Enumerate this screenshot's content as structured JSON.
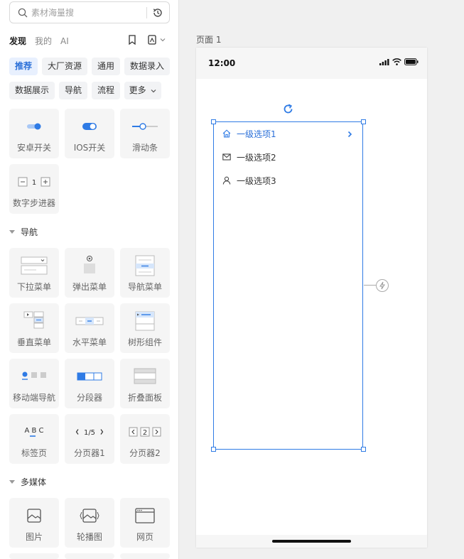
{
  "search": {
    "placeholder": "素材海量搜"
  },
  "tabs": [
    {
      "label": "发现",
      "active": true
    },
    {
      "label": "我的",
      "active": false
    },
    {
      "label": "AI",
      "active": false
    }
  ],
  "tags": [
    "推荐",
    "大厂资源",
    "通用",
    "数据录入",
    "数据展示",
    "导航",
    "流程",
    "更多"
  ],
  "controls_section": {
    "cards": [
      {
        "label": "安卓开关",
        "icon": "android-switch-icon"
      },
      {
        "label": "IOS开关",
        "icon": "ios-switch-icon"
      },
      {
        "label": "滑动条",
        "icon": "slider-icon"
      },
      {
        "label": "数字步进器",
        "icon": "number-stepper-icon",
        "stepper_value": "1"
      }
    ]
  },
  "nav_section": {
    "title": "导航",
    "cards": [
      {
        "label": "下拉菜单",
        "icon": "dropdown-menu-icon"
      },
      {
        "label": "弹出菜单",
        "icon": "popup-menu-icon"
      },
      {
        "label": "导航菜单",
        "icon": "nav-menu-icon"
      },
      {
        "label": "垂直菜单",
        "icon": "vertical-menu-icon"
      },
      {
        "label": "水平菜单",
        "icon": "horizontal-menu-icon"
      },
      {
        "label": "树形组件",
        "icon": "tree-component-icon"
      },
      {
        "label": "移动端导航",
        "icon": "mobile-nav-icon"
      },
      {
        "label": "分段器",
        "icon": "segmented-control-icon"
      },
      {
        "label": "折叠面板",
        "icon": "collapse-panel-icon"
      },
      {
        "label": "标签页",
        "icon": "tabs-icon",
        "thumb_text": "A B C"
      },
      {
        "label": "分页器1",
        "icon": "pagination-icon",
        "thumb_text": "1/5"
      },
      {
        "label": "分页器2",
        "icon": "pagination-icon",
        "thumb_text": "2"
      }
    ]
  },
  "media_section": {
    "title": "多媒体",
    "cards": [
      {
        "label": "图片",
        "icon": "image-icon"
      },
      {
        "label": "轮播图",
        "icon": "carousel-icon"
      },
      {
        "label": "网页",
        "icon": "webpage-icon"
      }
    ]
  },
  "canvas": {
    "page_title": "页面 1",
    "status_time": "12:00",
    "menu_items": [
      {
        "label": "一级选项1",
        "icon": "home-icon",
        "active": true
      },
      {
        "label": "一级选项2",
        "icon": "mail-icon",
        "active": false
      },
      {
        "label": "一级选项3",
        "icon": "user-icon",
        "active": false
      }
    ]
  },
  "colors": {
    "accent": "#2f7be5",
    "card_bg": "#f5f5f5",
    "tag_active_bg": "#e8f0fe"
  }
}
